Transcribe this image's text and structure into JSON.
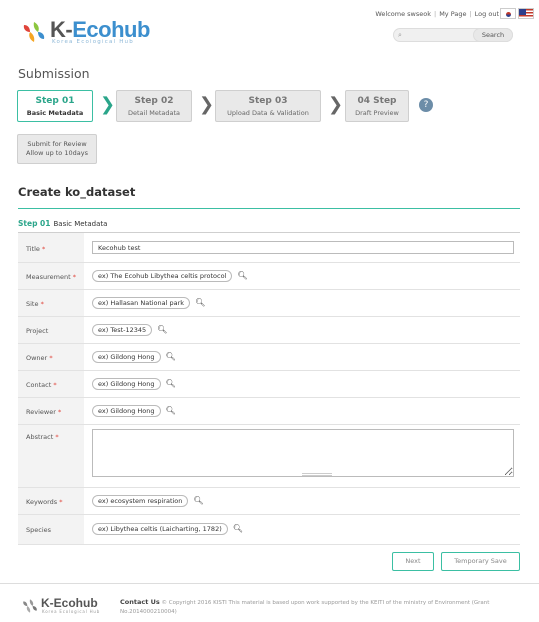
{
  "header": {
    "logo": {
      "title_prefix": "K-",
      "title_main": "Eco",
      "title_suffix": "hub",
      "subtitle": "Korea Ecological Hub"
    },
    "topnav": {
      "welcome": "Welcome swseok",
      "my_page": "My Page",
      "logout": "Log out"
    },
    "search": {
      "placeholder": "",
      "button": "Search"
    }
  },
  "submission": {
    "title": "Submission",
    "steps": [
      {
        "num": "Step 01",
        "label": "Basic Metadata",
        "active": true
      },
      {
        "num": "Step 02",
        "label": "Detail Metadata",
        "active": false
      },
      {
        "num": "Step 03",
        "label": "Upload Data & Validation",
        "active": false
      },
      {
        "num": "04 Step",
        "label": "Draft Preview",
        "active": false
      }
    ],
    "review": {
      "line1": "Submit for Review",
      "line2": "Allow up to 10days"
    }
  },
  "create": {
    "title": "Create ko_dataset",
    "step_num": "Step 01",
    "step_name": "Basic Metadata"
  },
  "form": {
    "title": {
      "label": "Title",
      "value": "Kecohub test"
    },
    "measurement": {
      "label": "Measurement",
      "tag": "ex) The Ecohub Libythea celtis protocol"
    },
    "site": {
      "label": "Site",
      "tag": "ex) Hallasan National park"
    },
    "project": {
      "label": "Project",
      "tag": "ex) Test-12345"
    },
    "owner": {
      "label": "Owner",
      "tag": "ex) Gildong Hong"
    },
    "contact": {
      "label": "Contact",
      "tag": "ex) Gildong Hong"
    },
    "reviewer": {
      "label": "Reviewer",
      "tag": "ex) Gildong Hong"
    },
    "abstract": {
      "label": "Abstract",
      "value": ""
    },
    "keywords": {
      "label": "Keywords",
      "tag": "ex) ecosystem respiration"
    },
    "species": {
      "label": "Species",
      "tag": "ex) Libythea celtis (Laicharting, 1782)"
    },
    "required_mark": "*"
  },
  "actions": {
    "next": "Next",
    "temp_save": "Temporary Save"
  },
  "footer": {
    "logo_title": "K-Ecohub",
    "logo_sub": "Korea Ecological Hub",
    "contact_label": "Contact Us",
    "copyright": "© Copyright 2016 KISTI This material is based upon work supported by the KEITI of the ministry of Environment (Grant No.2014000210004)"
  },
  "colors": {
    "brand_blue": "#3c8fce",
    "accent_green": "#2aa58a",
    "required_red": "#e0443a"
  }
}
